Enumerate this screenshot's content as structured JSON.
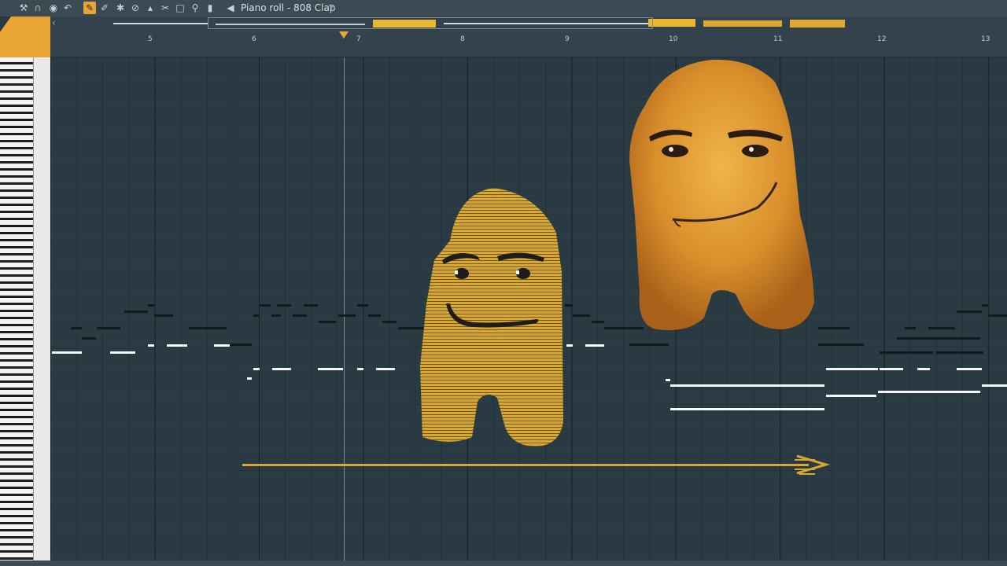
{
  "window": {
    "title": "Piano roll - 808 Clap"
  },
  "toolbar": {
    "icons": [
      "wrench-icon",
      "magnet-icon",
      "record-icon",
      "undo-icon",
      "pencil-icon",
      "brush-icon",
      "stamp-icon",
      "delete-icon",
      "mute-icon",
      "slice-icon",
      "select-icon",
      "zoom-icon",
      "playback-icon",
      "speaker-icon"
    ],
    "active_tool": "pencil-icon"
  },
  "timeline": {
    "bars": [
      "5",
      "6",
      "7",
      "8",
      "9",
      "10",
      "11",
      "12",
      "13"
    ]
  },
  "colors": {
    "accent": "#e9a534",
    "grid_bg": "#2b3b44",
    "note_white": "#f4f6f7",
    "note_black": "#121a1f"
  }
}
